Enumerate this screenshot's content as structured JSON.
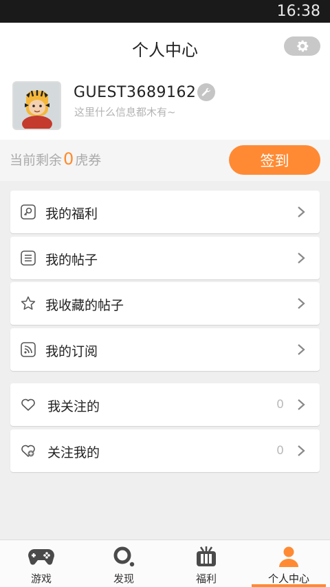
{
  "status_bar": {
    "time": "16:38"
  },
  "header": {
    "title": "个人中心",
    "settings_icon": "gear-icon"
  },
  "profile": {
    "username": "GUEST3689162",
    "bio": "这里什么信息都木有~",
    "edit_icon": "wrench-icon"
  },
  "coupon": {
    "prefix": "当前剩余",
    "count": "0",
    "unit": "虎券",
    "signin_label": "签到"
  },
  "menu_group1": [
    {
      "label": "我的福利",
      "icon": "key-icon"
    },
    {
      "label": "我的帖子",
      "icon": "list-icon"
    },
    {
      "label": "我收藏的帖子",
      "icon": "star-icon"
    },
    {
      "label": "我的订阅",
      "icon": "rss-icon"
    }
  ],
  "menu_group2": [
    {
      "label": "我关注的",
      "icon": "heart-icon",
      "count": "0"
    },
    {
      "label": "关注我的",
      "icon": "heart-plus-icon",
      "count": "0"
    }
  ],
  "tabs": [
    {
      "label": "游戏",
      "icon": "gamepad-icon",
      "active": false
    },
    {
      "label": "发现",
      "icon": "search-icon",
      "active": false
    },
    {
      "label": "福利",
      "icon": "gift-icon",
      "active": false
    },
    {
      "label": "个人中心",
      "icon": "person-icon",
      "active": true
    }
  ],
  "colors": {
    "accent": "#ff8a33",
    "status_bar": "#1a1a1a",
    "background": "#efefef"
  }
}
